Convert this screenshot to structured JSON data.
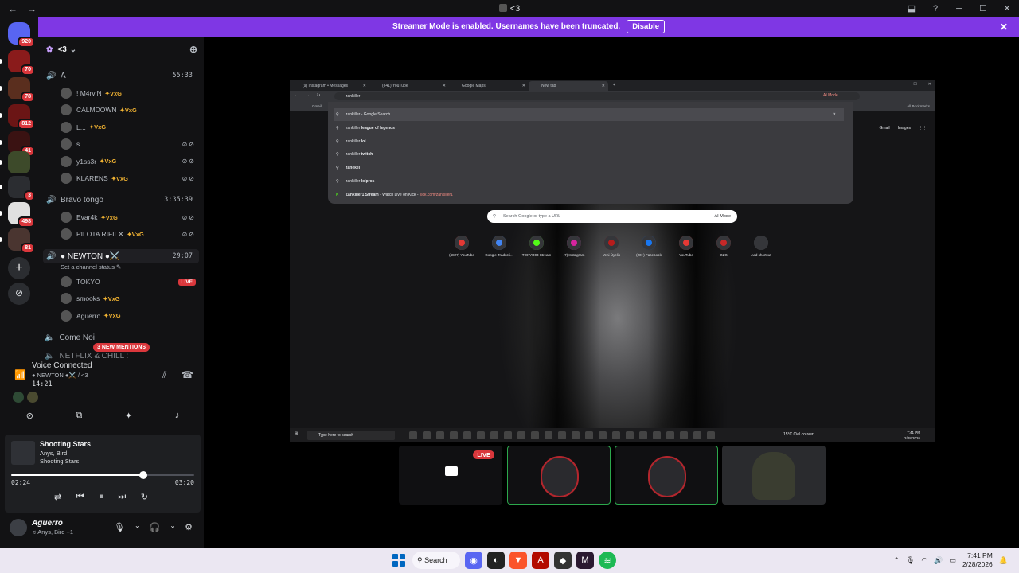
{
  "titlebar": {
    "title": "<3",
    "nav_back": "←",
    "nav_fwd": "→",
    "inbox_icon": "⬓",
    "help": "?",
    "min": "─",
    "max": "☐",
    "close": "✕"
  },
  "rail": {
    "home_badge": "920",
    "servers": [
      {
        "badge": "70"
      },
      {
        "badge": "78"
      },
      {
        "badge": "812"
      },
      {
        "badge": "41"
      },
      {
        "badge": ""
      },
      {
        "badge": "3"
      },
      {
        "badge": "498"
      },
      {
        "badge": "81"
      }
    ],
    "add": "+",
    "discover": "⊘"
  },
  "banner": {
    "text": "Streamer Mode is enabled. Usernames have been truncated.",
    "button": "Disable",
    "close": "✕"
  },
  "server": {
    "name": "<3",
    "chevron": "⌄",
    "add_member": "⊕"
  },
  "voice_channels": [
    {
      "name": "A",
      "time": "55:33"
    },
    {
      "name": "Bravo tongo",
      "time": "3:35:39"
    },
    {
      "name": "● NEWTON ●⚔️",
      "time": "29:07"
    }
  ],
  "users_a": [
    {
      "name": "! M4rviN",
      "tag": "VxG",
      "muted": false
    },
    {
      "name": "CALMDOWN",
      "tag": "VxG",
      "muted": false
    },
    {
      "name": "L...",
      "tag": "VxG",
      "muted": false
    },
    {
      "name": "s...",
      "tag": "",
      "muted": true
    },
    {
      "name": "y1ss3r",
      "tag": "VxG",
      "muted": true
    },
    {
      "name": "KLARENS",
      "tag": "VxG",
      "muted": true
    }
  ],
  "users_bravo": [
    {
      "name": "Evar4k",
      "tag": "VxG",
      "muted": true
    },
    {
      "name": "PILOTA RIFII ✕",
      "tag": "VxG",
      "muted": true
    }
  ],
  "newton_status": "Set a channel status ✎",
  "users_newton": [
    {
      "name": "TOKYO",
      "tag": "",
      "live": "LIVE"
    },
    {
      "name": "smooks",
      "tag": "VxG",
      "live": ""
    },
    {
      "name": "Aguerro",
      "tag": "VxG",
      "live": ""
    }
  ],
  "text_channels": [
    {
      "name": "Come Noi"
    },
    {
      "name": "NETFLIX & CHILL :"
    }
  ],
  "mentions": "3 NEW MENTIONS",
  "voice": {
    "status": "Voice Connected",
    "channel": "● NEWTON ●⚔️ / <3",
    "time": "14:21"
  },
  "music": {
    "track": "Shooting Stars",
    "artist": "Anys, Bird",
    "album": "Shooting Stars",
    "elapsed": "02:24",
    "duration": "03:20",
    "progress": 0.72
  },
  "user": {
    "name": "Aguerro",
    "activity": "♫ Anys, Bird +1"
  },
  "browser": {
    "tabs": [
      {
        "label": "(9) Instagram • Messages"
      },
      {
        "label": "(641) YouTube"
      },
      {
        "label": "Google Maps"
      },
      {
        "label": "New tab"
      }
    ],
    "address": "zankiller",
    "ai_mode": "AI Mode",
    "all_bookmarks": "All Bookmarks",
    "gmail_bm": "Gmail",
    "suggestions": [
      {
        "pre": "zankiller",
        "bold": "",
        "post": " - Google Search",
        "kick": ""
      },
      {
        "pre": "zankiller ",
        "bold": "league of legends",
        "post": "",
        "kick": ""
      },
      {
        "pre": "zankiller ",
        "bold": "lol",
        "post": "",
        "kick": ""
      },
      {
        "pre": "zankiller ",
        "bold": "twitch",
        "post": "",
        "kick": ""
      },
      {
        "pre": "",
        "bold": "zanekel",
        "post": "",
        "kick": ""
      },
      {
        "pre": "zankiller ",
        "bold": "lolpros",
        "post": "",
        "kick": ""
      },
      {
        "pre": "",
        "bold": "Zankiller1 Stream",
        "post": " - Watch Live on Kick - ",
        "kick": "kick.com/zankiller1"
      }
    ],
    "search_placeholder": "Search Google or type a URL",
    "search_ai": "AI Mode",
    "gmail": "Gmail",
    "images": "Images",
    "shortcuts": [
      {
        "label": "(4827) YouTube",
        "color": "#e53935"
      },
      {
        "label": "Google Traducti...",
        "color": "#4285f4"
      },
      {
        "label": "TOKYO03 Stream",
        "color": "#53fc18"
      },
      {
        "label": "(7) Instagram",
        "color": "#d6249f"
      },
      {
        "label": "Yeni Üyelik",
        "color": "#b71c1c"
      },
      {
        "label": "(20+) Facebook",
        "color": "#1877f2"
      },
      {
        "label": "YouTube",
        "color": "#e53935"
      },
      {
        "label": "G2G",
        "color": "#c62828"
      },
      {
        "label": "Add shortcut",
        "color": "#35363a"
      }
    ],
    "taskbar_search": "Type here to search",
    "weather": "15°C  Ciel couvert",
    "clock_time": "7:41 PM",
    "clock_date": "2/28/2026"
  },
  "tiles": {
    "live": "LIVE"
  },
  "taskbar": {
    "search": "Search",
    "time": "7:41 PM",
    "date": "2/28/2026"
  }
}
